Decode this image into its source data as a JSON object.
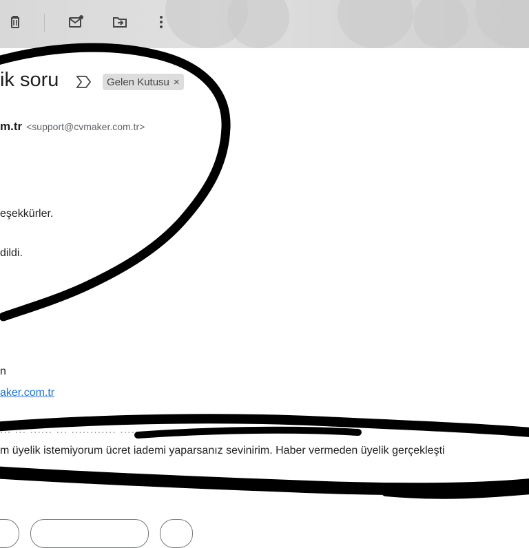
{
  "toolbar": {
    "icons": [
      "delete-icon",
      "mark-unread-icon",
      "move-to-icon",
      "more-icon"
    ]
  },
  "email": {
    "subject": "ik soru",
    "label": "Gelen Kutusu",
    "label_remove": "×",
    "sender_name": "m.tr",
    "sender_email": "<support@cvmaker.com.tr>",
    "body_line1": "eşekkürler.",
    "body_line2": "dildi.",
    "signature_line": "n",
    "signature_link": "aker.com.tr",
    "quoted_header": "... ... ...:..  ...  ............ .............  ...........",
    "quoted_text": "m üyelik istemiyorum ücret iademi yaparsanız sevinirim. Haber vermeden üyelik gerçekleşti"
  },
  "colors": {
    "link": "#1a73e8",
    "chip_bg": "#dddddd",
    "scribble": "#000000"
  }
}
